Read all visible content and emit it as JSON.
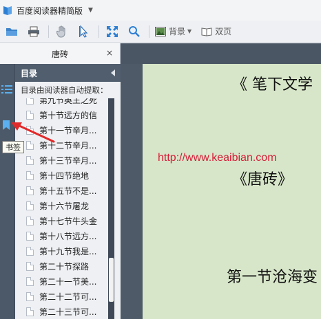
{
  "app": {
    "title": "百度阅读器精简版",
    "logo_icon": "baidu-reader-logo-icon"
  },
  "toolbar": {
    "background_label": "背景",
    "double_page_label": "双页",
    "icons": [
      "open-folder-icon",
      "print-icon",
      "hand-icon",
      "select-cursor-icon",
      "fullscreen-icon",
      "zoom-icon",
      "background-icon",
      "book-icon"
    ]
  },
  "tab": {
    "label": "唐砖",
    "close": "×"
  },
  "sidebar": {
    "header": "目录",
    "subtitle": "目录由阅读器自动提取：",
    "items": [
      "第九节英王之死",
      "第十节远方的信",
      "第十一节辛月...",
      "第十二节辛月...",
      "第十三节辛月...",
      "第十四节绝地",
      "第十五节不是...",
      "第十六节屠龙",
      "第十七节牛头金",
      "第十八节远方...",
      "第十九节我是...",
      "第二十节探路",
      "第二十一节美...",
      "第二十二节可...",
      "第二十三节可..."
    ]
  },
  "tooltip": "书签",
  "page": {
    "heading": "《 笔下文学",
    "url": "http://www.keaibian.com",
    "book_title": "《唐砖》",
    "chapter": "第一节沧海变"
  },
  "colors": {
    "page_bg": "#d7e6c9",
    "url": "#d81b37",
    "panel_dark": "#4c5969",
    "accent": "#3a7bd5"
  }
}
